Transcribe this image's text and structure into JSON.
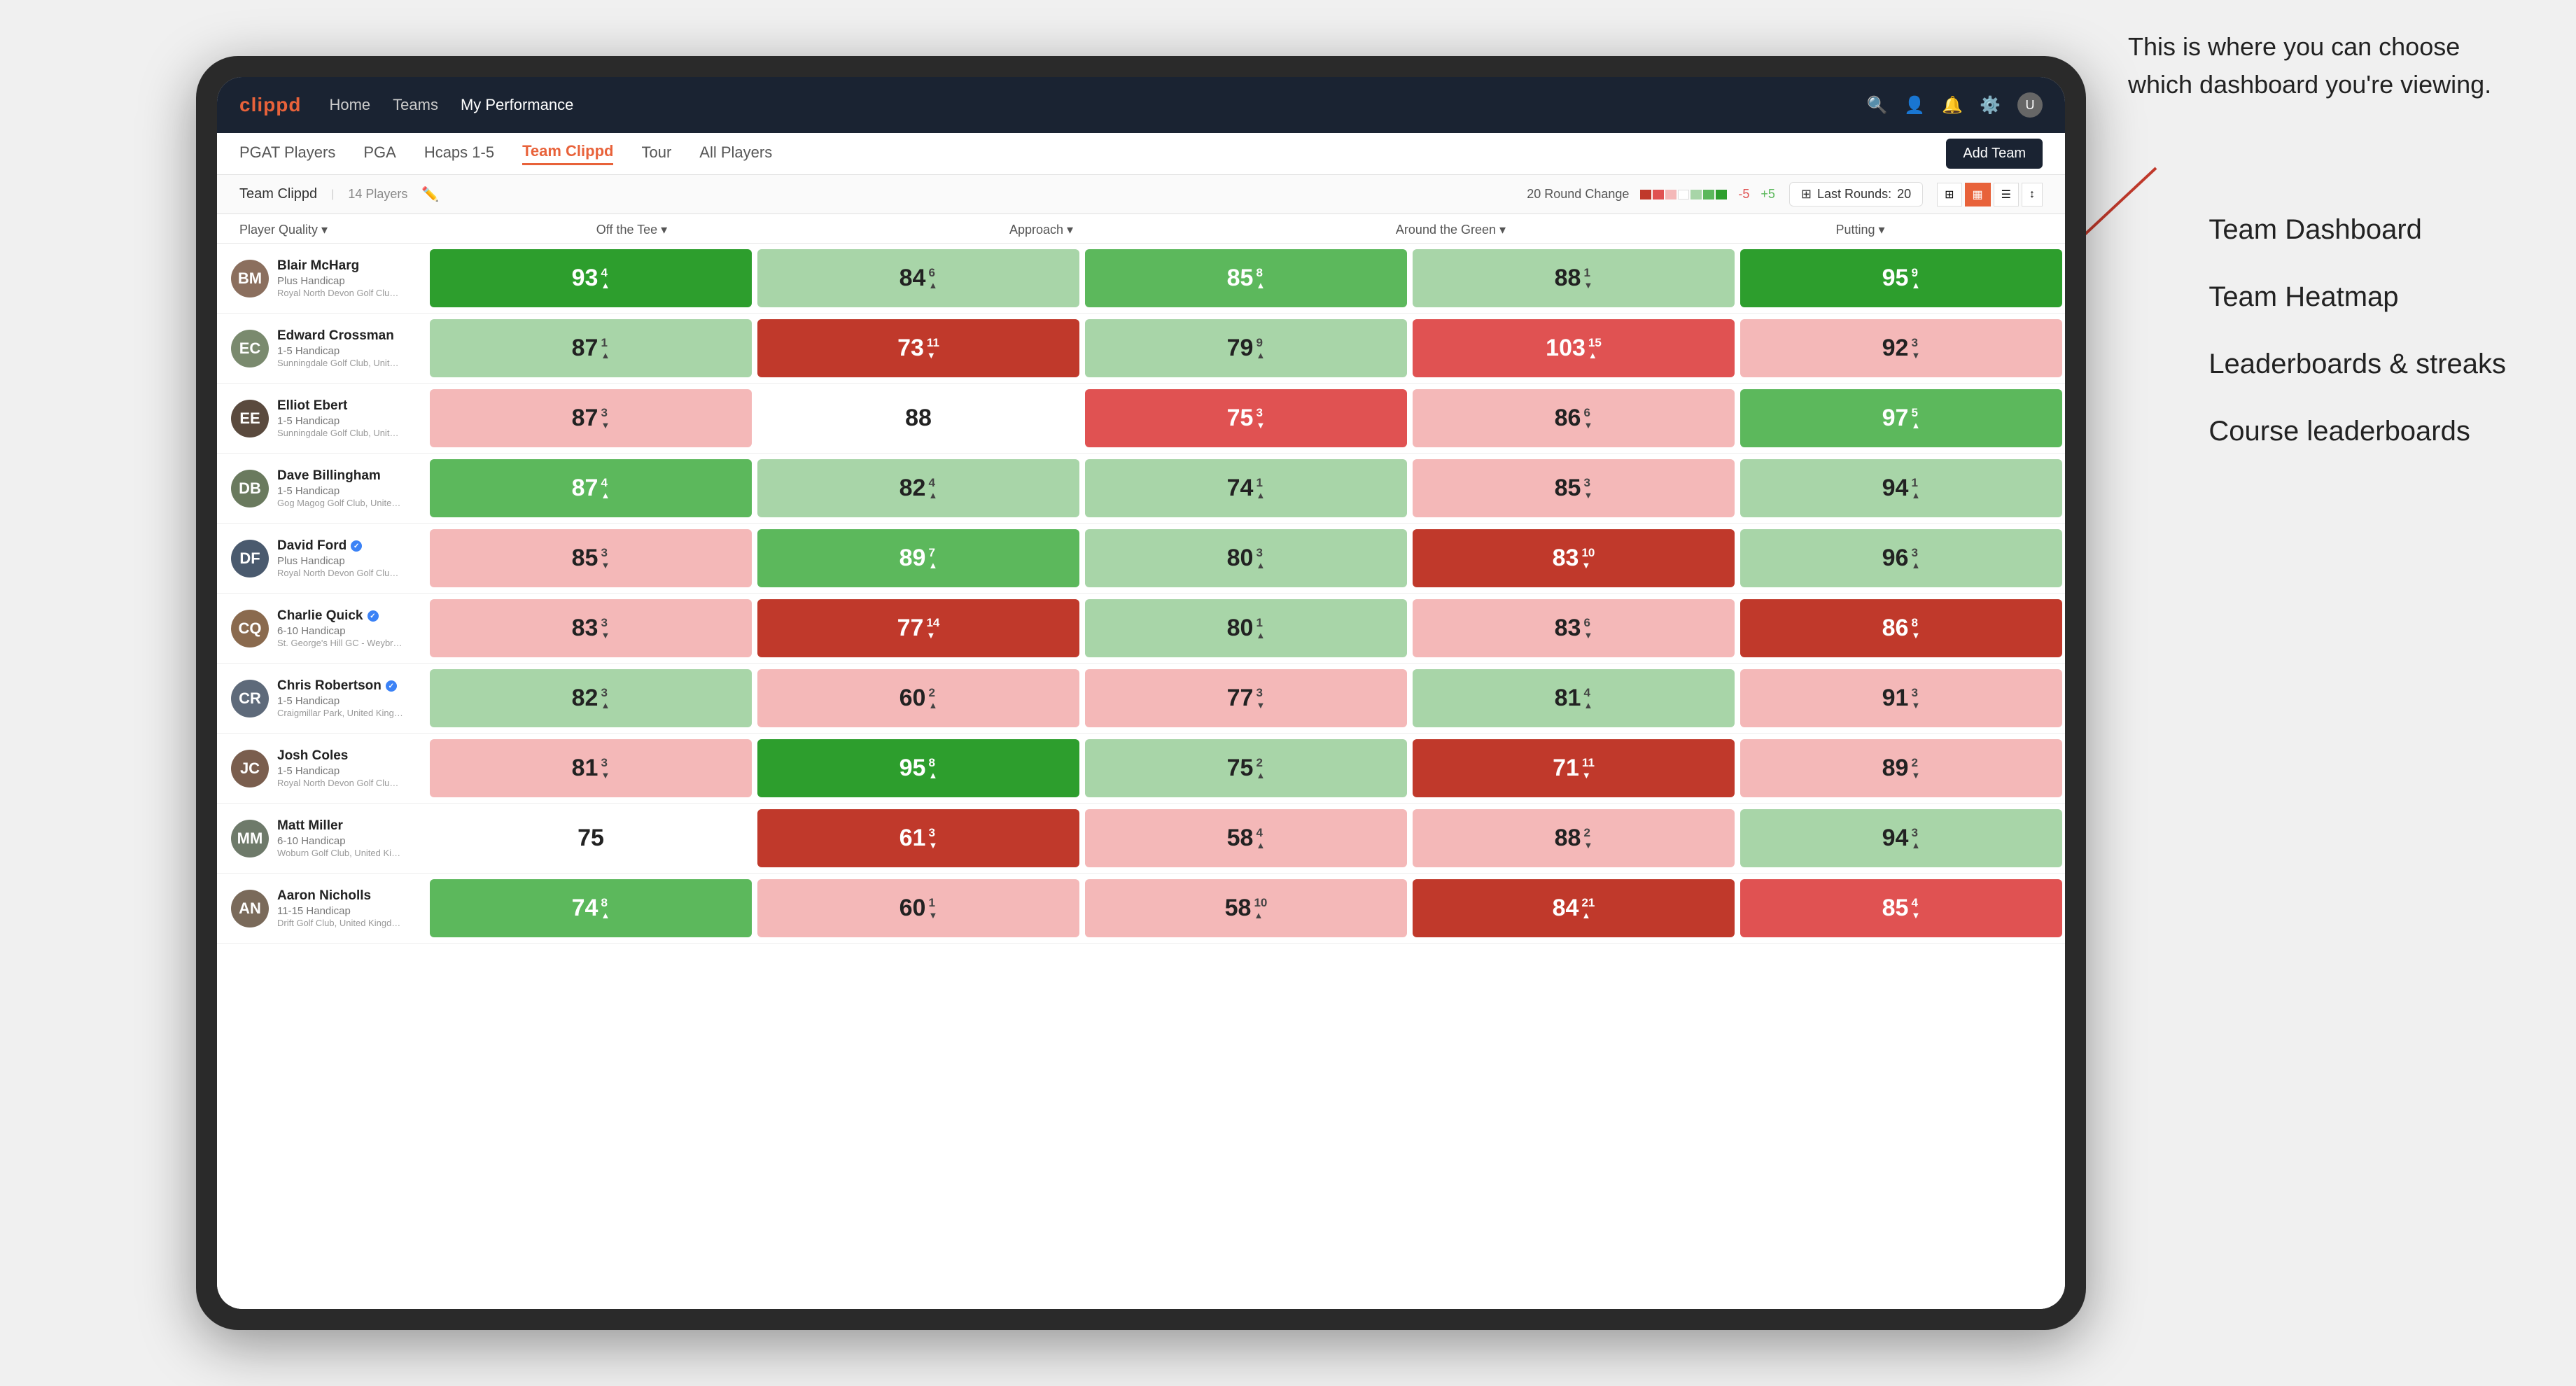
{
  "annotation": {
    "text": "This is where you can choose which dashboard you're viewing.",
    "sidebar_items": [
      "Team Dashboard",
      "Team Heatmap",
      "Leaderboards & streaks",
      "Course leaderboards"
    ]
  },
  "nav": {
    "logo": "clippd",
    "links": [
      "Home",
      "Teams",
      "My Performance"
    ],
    "active_link": "My Performance"
  },
  "tabs": [
    "PGAT Players",
    "PGA",
    "Hcaps 1-5",
    "Team Clippd",
    "Tour",
    "All Players"
  ],
  "active_tab": "Team Clippd",
  "add_team_label": "Add Team",
  "subheader": {
    "team_name": "Team Clippd",
    "separator": "|",
    "player_count": "14 Players",
    "round_change_label": "20 Round Change",
    "change_from": "-5",
    "change_to": "+5",
    "last_rounds_label": "Last Rounds:",
    "last_rounds_value": "20"
  },
  "col_headers": {
    "player": "Player Quality ▾",
    "off_tee": "Off the Tee ▾",
    "approach": "Approach ▾",
    "around_green": "Around the Green ▾",
    "putting": "Putting ▾"
  },
  "players": [
    {
      "name": "Blair McHarg",
      "handicap": "Plus Handicap",
      "club": "Royal North Devon Golf Club, United Kingdom",
      "initials": "BM",
      "avatar_color": "#8B6F5E",
      "scores": {
        "quality": {
          "value": 93,
          "change": 4,
          "trend": "up",
          "bg": "bg-green-dark"
        },
        "off_tee": {
          "value": 84,
          "change": 6,
          "trend": "up",
          "bg": "bg-green-light"
        },
        "approach": {
          "value": 85,
          "change": 8,
          "trend": "up",
          "bg": "bg-green-mid"
        },
        "around_green": {
          "value": 88,
          "change": 1,
          "trend": "down",
          "bg": "bg-green-light"
        },
        "putting": {
          "value": 95,
          "change": 9,
          "trend": "up",
          "bg": "bg-green-dark"
        }
      }
    },
    {
      "name": "Edward Crossman",
      "handicap": "1-5 Handicap",
      "club": "Sunningdale Golf Club, United Kingdom",
      "initials": "EC",
      "avatar_color": "#7A8A6E",
      "scores": {
        "quality": {
          "value": 87,
          "change": 1,
          "trend": "up",
          "bg": "bg-green-light"
        },
        "off_tee": {
          "value": 73,
          "change": 11,
          "trend": "down",
          "bg": "bg-red-dark"
        },
        "approach": {
          "value": 79,
          "change": 9,
          "trend": "up",
          "bg": "bg-green-light"
        },
        "around_green": {
          "value": 103,
          "change": 15,
          "trend": "up",
          "bg": "bg-red-mid"
        },
        "putting": {
          "value": 92,
          "change": 3,
          "trend": "down",
          "bg": "bg-red-light"
        }
      }
    },
    {
      "name": "Elliot Ebert",
      "handicap": "1-5 Handicap",
      "club": "Sunningdale Golf Club, United Kingdom",
      "initials": "EE",
      "avatar_color": "#5A4A3E",
      "scores": {
        "quality": {
          "value": 87,
          "change": 3,
          "trend": "down",
          "bg": "bg-red-light"
        },
        "off_tee": {
          "value": 88,
          "change": 0,
          "trend": null,
          "bg": "bg-white"
        },
        "approach": {
          "value": 75,
          "change": 3,
          "trend": "down",
          "bg": "bg-red-mid"
        },
        "around_green": {
          "value": 86,
          "change": 6,
          "trend": "down",
          "bg": "bg-red-light"
        },
        "putting": {
          "value": 97,
          "change": 5,
          "trend": "up",
          "bg": "bg-green-mid"
        }
      }
    },
    {
      "name": "Dave Billingham",
      "handicap": "1-5 Handicap",
      "club": "Gog Magog Golf Club, United Kingdom",
      "initials": "DB",
      "avatar_color": "#6A7A5E",
      "scores": {
        "quality": {
          "value": 87,
          "change": 4,
          "trend": "up",
          "bg": "bg-green-mid"
        },
        "off_tee": {
          "value": 82,
          "change": 4,
          "trend": "up",
          "bg": "bg-green-light"
        },
        "approach": {
          "value": 74,
          "change": 1,
          "trend": "up",
          "bg": "bg-green-light"
        },
        "around_green": {
          "value": 85,
          "change": 3,
          "trend": "down",
          "bg": "bg-red-light"
        },
        "putting": {
          "value": 94,
          "change": 1,
          "trend": "up",
          "bg": "bg-green-light"
        }
      }
    },
    {
      "name": "David Ford",
      "handicap": "Plus Handicap",
      "club": "Royal North Devon Golf Club, United Kingdom",
      "initials": "DF",
      "avatar_color": "#4A5A6E",
      "verified": true,
      "scores": {
        "quality": {
          "value": 85,
          "change": 3,
          "trend": "down",
          "bg": "bg-red-light"
        },
        "off_tee": {
          "value": 89,
          "change": 7,
          "trend": "up",
          "bg": "bg-green-mid"
        },
        "approach": {
          "value": 80,
          "change": 3,
          "trend": "up",
          "bg": "bg-green-light"
        },
        "around_green": {
          "value": 83,
          "change": 10,
          "trend": "down",
          "bg": "bg-red-dark"
        },
        "putting": {
          "value": 96,
          "change": 3,
          "trend": "up",
          "bg": "bg-green-light"
        }
      }
    },
    {
      "name": "Charlie Quick",
      "handicap": "6-10 Handicap",
      "club": "St. George's Hill GC - Weybridge, Surrey, Uni...",
      "initials": "CQ",
      "avatar_color": "#8A6A4E",
      "verified": true,
      "scores": {
        "quality": {
          "value": 83,
          "change": 3,
          "trend": "down",
          "bg": "bg-red-light"
        },
        "off_tee": {
          "value": 77,
          "change": 14,
          "trend": "down",
          "bg": "bg-red-dark"
        },
        "approach": {
          "value": 80,
          "change": 1,
          "trend": "up",
          "bg": "bg-green-light"
        },
        "around_green": {
          "value": 83,
          "change": 6,
          "trend": "down",
          "bg": "bg-red-light"
        },
        "putting": {
          "value": 86,
          "change": 8,
          "trend": "down",
          "bg": "bg-red-dark"
        }
      }
    },
    {
      "name": "Chris Robertson",
      "handicap": "1-5 Handicap",
      "club": "Craigmillar Park, United Kingdom",
      "initials": "CR",
      "avatar_color": "#5E6A7A",
      "verified": true,
      "scores": {
        "quality": {
          "value": 82,
          "change": 3,
          "trend": "up",
          "bg": "bg-green-light"
        },
        "off_tee": {
          "value": 60,
          "change": 2,
          "trend": "up",
          "bg": "bg-red-light"
        },
        "approach": {
          "value": 77,
          "change": 3,
          "trend": "down",
          "bg": "bg-red-light"
        },
        "around_green": {
          "value": 81,
          "change": 4,
          "trend": "up",
          "bg": "bg-green-light"
        },
        "putting": {
          "value": 91,
          "change": 3,
          "trend": "down",
          "bg": "bg-red-light"
        }
      }
    },
    {
      "name": "Josh Coles",
      "handicap": "1-5 Handicap",
      "club": "Royal North Devon Golf Club, United Kingdom",
      "initials": "JC",
      "avatar_color": "#7A5E4E",
      "scores": {
        "quality": {
          "value": 81,
          "change": 3,
          "trend": "down",
          "bg": "bg-red-light"
        },
        "off_tee": {
          "value": 95,
          "change": 8,
          "trend": "up",
          "bg": "bg-green-dark"
        },
        "approach": {
          "value": 75,
          "change": 2,
          "trend": "up",
          "bg": "bg-green-light"
        },
        "around_green": {
          "value": 71,
          "change": 11,
          "trend": "down",
          "bg": "bg-red-dark"
        },
        "putting": {
          "value": 89,
          "change": 2,
          "trend": "down",
          "bg": "bg-red-light"
        }
      }
    },
    {
      "name": "Matt Miller",
      "handicap": "6-10 Handicap",
      "club": "Woburn Golf Club, United Kingdom",
      "initials": "MM",
      "avatar_color": "#6E7A6A",
      "scores": {
        "quality": {
          "value": 75,
          "change": 0,
          "trend": null,
          "bg": "bg-white"
        },
        "off_tee": {
          "value": 61,
          "change": 3,
          "trend": "down",
          "bg": "bg-red-dark"
        },
        "approach": {
          "value": 58,
          "change": 4,
          "trend": "up",
          "bg": "bg-red-light"
        },
        "around_green": {
          "value": 88,
          "change": 2,
          "trend": "down",
          "bg": "bg-red-light"
        },
        "putting": {
          "value": 94,
          "change": 3,
          "trend": "up",
          "bg": "bg-green-light"
        }
      }
    },
    {
      "name": "Aaron Nicholls",
      "handicap": "11-15 Handicap",
      "club": "Drift Golf Club, United Kingdom",
      "initials": "AN",
      "avatar_color": "#7A6A5A",
      "scores": {
        "quality": {
          "value": 74,
          "change": 8,
          "trend": "up",
          "bg": "bg-green-mid"
        },
        "off_tee": {
          "value": 60,
          "change": 1,
          "trend": "down",
          "bg": "bg-red-light"
        },
        "approach": {
          "value": 58,
          "change": 10,
          "trend": "up",
          "bg": "bg-red-light"
        },
        "around_green": {
          "value": 84,
          "change": 21,
          "trend": "up",
          "bg": "bg-red-dark"
        },
        "putting": {
          "value": 85,
          "change": 4,
          "trend": "down",
          "bg": "bg-red-mid"
        }
      }
    }
  ]
}
